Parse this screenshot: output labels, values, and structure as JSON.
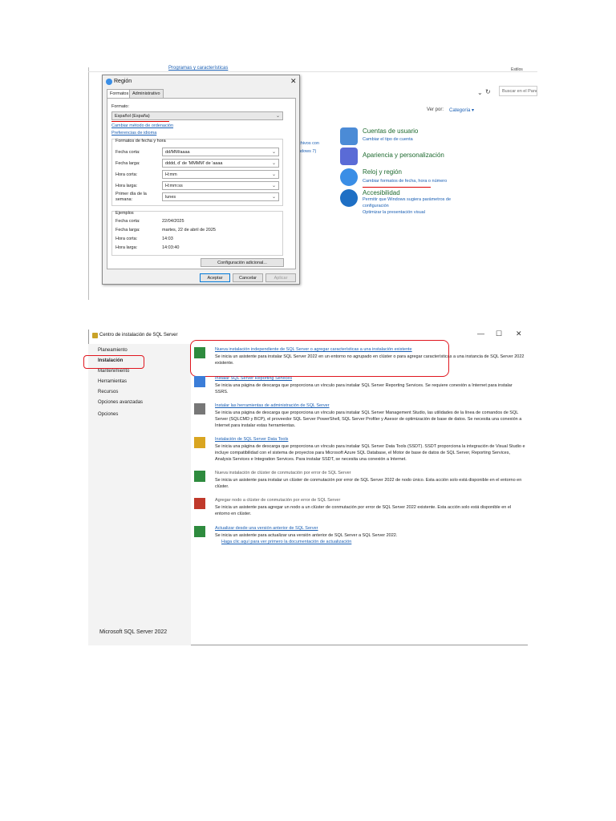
{
  "control_panel": {
    "top_link": "Programas y características",
    "estilos": "Estilos",
    "search_placeholder": "Buscar en el Panel de control",
    "view_by_label": "Ver por:",
    "view_by_value": "Categoría ▾",
    "left_fragments": [
      "chivos con",
      "",
      "ndows 7)"
    ],
    "categories": [
      {
        "title": "Cuentas de usuario",
        "links": [
          "Cambiar el tipo de cuenta"
        ],
        "color": "#4b8bd6"
      },
      {
        "title": "Apariencia y personalización",
        "links": [],
        "color": "#5a6bd6"
      },
      {
        "title": "Reloj y región",
        "links": [
          "Cambiar formatos de fecha, hora o número"
        ],
        "color": "#3a8ee6"
      },
      {
        "title": "Accesibilidad",
        "links": [
          "Permitir que Windows sugiera parámetros de configuración",
          "Optimizar la presentación visual"
        ],
        "color": "#1e6fc4"
      }
    ]
  },
  "region_dialog": {
    "title": "Región",
    "tabs": [
      "Formatos",
      "Administrativo"
    ],
    "format_label": "Formato:",
    "format_value": "Español (España)",
    "link_sort": "Cambiar método de ordenación",
    "link_lang": "Preferencias de idioma",
    "datetime_group": "Formatos de fecha y hora",
    "fields": [
      {
        "label": "Fecha corta:",
        "value": "dd/MM/aaaa"
      },
      {
        "label": "Fecha larga:",
        "value": "dddd, d' de 'MMMM' de 'aaaa"
      },
      {
        "label": "Hora corta:",
        "value": "H:mm"
      },
      {
        "label": "Hora larga:",
        "value": "H:mm:ss"
      },
      {
        "label": "Primer día de la semana:",
        "value": "lunes"
      }
    ],
    "examples_title": "Ejemplos",
    "examples": [
      {
        "label": "Fecha corta:",
        "value": "22/04/2025"
      },
      {
        "label": "Fecha larga:",
        "value": "martes, 22 de abril de 2025"
      },
      {
        "label": "Hora corta:",
        "value": "14:03"
      },
      {
        "label": "Hora larga:",
        "value": "14:03:40"
      }
    ],
    "additional_button": "Configuración adicional...",
    "ok": "Aceptar",
    "cancel": "Cancelar",
    "apply": "Aplicar"
  },
  "sql_center": {
    "title": "Centro de instalación de SQL Server",
    "window_buttons": [
      "—",
      "☐",
      "✕"
    ],
    "sidebar": [
      "Planeamiento",
      "Instalación",
      "Mantenimiento",
      "Herramientas",
      "Recursos",
      "Opciones avanzadas",
      "Opciones"
    ],
    "footer": "Microsoft SQL Server 2022",
    "entries": [
      {
        "title": "Nueva instalación independiente de SQL Server o agregar características a una instalación existente",
        "desc": "Se inicia un asistente para instalar SQL Server 2022 en un entorno no agrupado en clúster o para agregar características a una instancia de SQL Server 2022 existente.",
        "link2": "",
        "enabled": true,
        "color": "#2e8b3e"
      },
      {
        "title": "Instalar SQL Server Reporting Services",
        "desc": "Se inicia una página de descarga que proporciona un vínculo para instalar SQL Server Reporting Services. Se requiere conexión a Internet para instalar SSRS.",
        "link2": "",
        "enabled": true,
        "color": "#3b7dd8"
      },
      {
        "title": "Instalar las herramientas de administración de SQL Server",
        "desc": "Se inicia una página de descarga que proporciona un vínculo para instalar SQL Server Management Studio, las utilidades de la línea de comandos de SQL Server (SQLCMD y BCP), el proveedor SQL Server PowerShell, SQL Server Profiler y Asesor de optimización de base de datos. Se necesita una conexión a Internet para instalar estas herramientas.",
        "link2": "",
        "enabled": true,
        "color": "#777777"
      },
      {
        "title": "Instalación de SQL Server Data Tools",
        "desc": "Se inicia una página de descarga que proporciona un vínculo para instalar SQL Server Data Tools (SSDT). SSDT proporciona la integración de Visual Studio e incluye compatibilidad con el sistema de proyectos para Microsoft Azure SQL Database, el Motor de base de datos de SQL Server, Reporting Services, Analysis Services e Integration Services. Para instalar SSDT, se necesita una conexión a Internet.",
        "link2": "",
        "enabled": true,
        "color": "#d9a521"
      },
      {
        "title": "Nueva instalación de clúster de conmutación por error de SQL Server",
        "desc": "Se inicia un asistente para instalar un clúster de conmutación por error de SQL Server 2022 de nodo único. Esta acción solo está disponible en el entorno en clúster.",
        "link2": "",
        "enabled": false,
        "color": "#2e8b3e"
      },
      {
        "title": "Agregar nodo a clúster de conmutación por error de SQL Server",
        "desc": "Se inicia un asistente para agregar un nodo a un clúster de conmutación por error de SQL Server 2022 existente. Esta acción solo está disponible en el entorno en clúster.",
        "link2": "",
        "enabled": false,
        "color": "#c0392b"
      },
      {
        "title": "Actualizar desde una versión anterior de SQL Server",
        "desc": "Se inicia un asistente para actualizar una versión anterior de SQL Server a SQL Server 2022.",
        "link2": "Haga clic aquí para ver primero la documentación de actualización",
        "enabled": true,
        "color": "#2e8b3e"
      }
    ]
  }
}
